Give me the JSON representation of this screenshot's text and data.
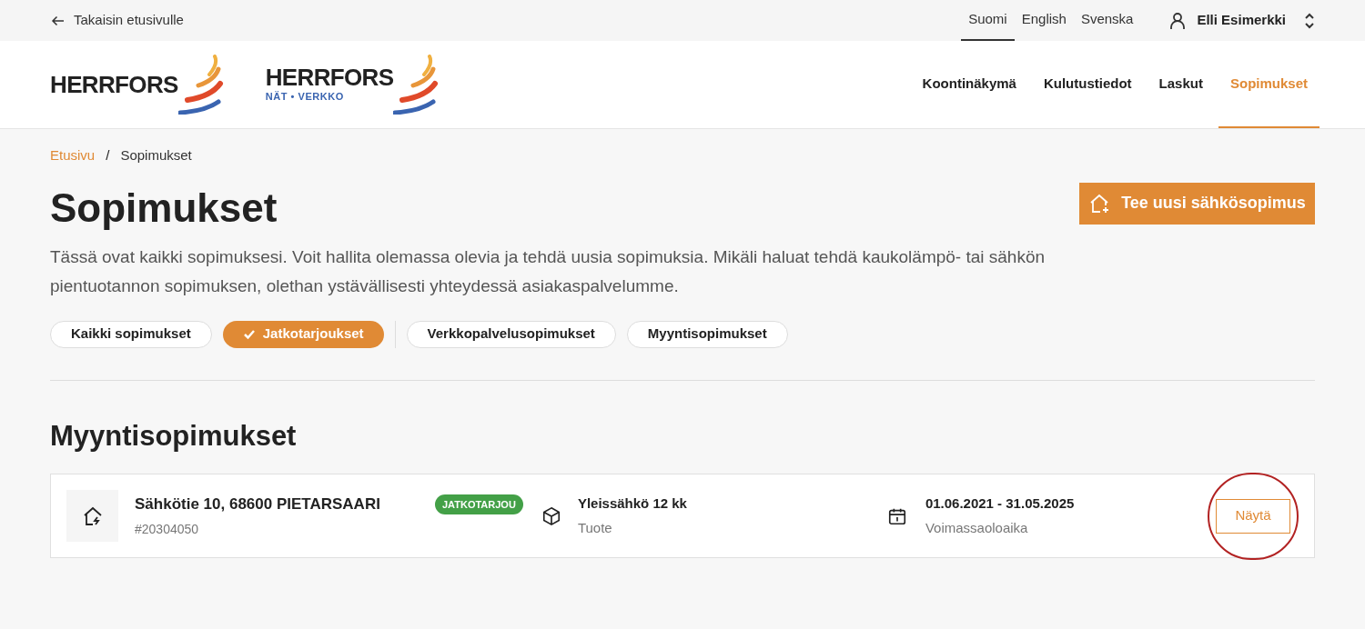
{
  "top_bar": {
    "back_link": "Takaisin etusivulle",
    "languages": [
      {
        "label": "Suomi",
        "selected": true
      },
      {
        "label": "English",
        "selected": false
      },
      {
        "label": "Svenska",
        "selected": false
      }
    ],
    "user": "Elli Esimerkki"
  },
  "logos": [
    {
      "name": "HERRFORS"
    },
    {
      "name": "HERRFORS",
      "subtitle": "NÄT • VERKKO"
    }
  ],
  "nav": [
    {
      "label": "Koontinäkymä",
      "selected": false
    },
    {
      "label": "Kulutustiedot",
      "selected": false
    },
    {
      "label": "Laskut",
      "selected": false
    },
    {
      "label": "Sopimukset",
      "selected": true
    }
  ],
  "breadcrumb": {
    "items": [
      "Etusivu",
      "Sopimukset"
    ],
    "separator": "/"
  },
  "page": {
    "title": "Sopimukset",
    "description": "Tässä ovat kaikki sopimuksesi. Voit hallita olemassa olevia ja tehdä uusia sopimuksia. Mikäli haluat tehdä kaukolämpö- tai sähkön pientuotannon sopimuksen, olethan ystävällisesti yhteydessä asiakaspalvelumme.",
    "new_button": "Tee uusi sähkösopimus"
  },
  "filters": [
    {
      "label": "Kaikki sopimukset",
      "selected": false
    },
    {
      "label": "Jatkotarjoukset",
      "selected": true
    },
    {
      "label": "Verkkopalvelusopimukset",
      "selected": false
    },
    {
      "label": "Myyntisopimukset",
      "selected": false
    }
  ],
  "section": {
    "title": "Myyntisopimukset",
    "contracts": [
      {
        "address": "Sähkötie 10, 68600 PIETARSAARI",
        "number": "#20304050",
        "badge": "JATKOTARJOU",
        "product": "Yleissähkö 12 kk",
        "product_label": "Tuote",
        "period": "01.06.2021 - 31.05.2025",
        "period_label": "Voimassaoloaika",
        "button": "Näytä",
        "highlighted": true
      }
    ]
  }
}
